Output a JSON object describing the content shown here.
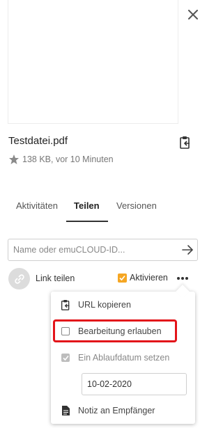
{
  "file": {
    "name": "Testdatei.pdf",
    "meta": "138 KB, vor 10 Minuten"
  },
  "tabs": [
    {
      "label": "Aktivitäten",
      "active": false
    },
    {
      "label": "Teilen",
      "active": true
    },
    {
      "label": "Versionen",
      "active": false
    }
  ],
  "share": {
    "input_placeholder": "Name oder emuCLOUD-ID...",
    "input_value": ""
  },
  "link_share": {
    "label": "Link teilen",
    "activate_label": "Aktivieren",
    "activate_checked": true
  },
  "menu": {
    "copy_url_label": "URL kopieren",
    "allow_edit_label": "Bearbeitung erlauben",
    "allow_edit_checked": false,
    "expiry_label": "Ein Ablaufdatum setzen",
    "expiry_checked": true,
    "expiry_date": "10-02-2020",
    "note_label": "Notiz an Empfänger"
  },
  "colors": {
    "accent_checkbox": "#f5a623",
    "highlight_border": "#e3141a"
  },
  "icons": [
    "close-icon",
    "clipboard-icon",
    "star-icon",
    "arrow-right-icon",
    "link-icon",
    "more-icon",
    "note-icon"
  ]
}
